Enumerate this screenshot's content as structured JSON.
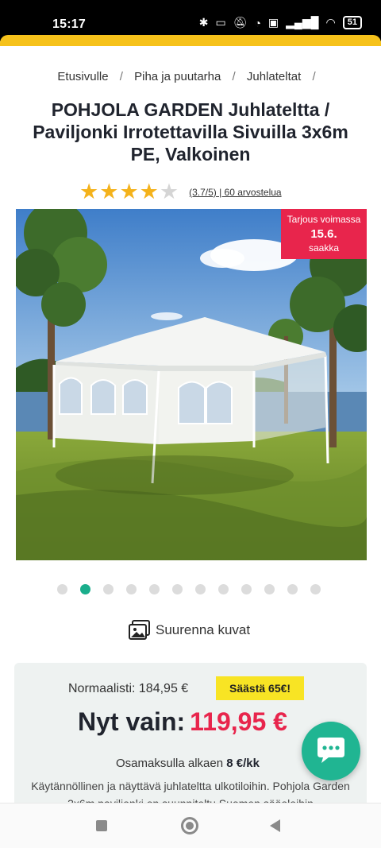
{
  "status_bar": {
    "time": "15:17",
    "battery": "51",
    "icons": [
      "bluetooth-icon",
      "nfc-icon",
      "mute-icon",
      "alarm-icon",
      "volte-icon",
      "signal-icon",
      "wifi-icon",
      "battery-icon"
    ]
  },
  "breadcrumb": [
    "Etusivulle",
    "Piha ja puutarha",
    "Juhlateltat"
  ],
  "product": {
    "title": "POHJOLA GARDEN Juhlateltta / Paviljonki Irrotettavilla Sivuilla 3x6m PE, Valkoinen",
    "rating_value": 3.7,
    "rating_max": 5,
    "rating_text": "(3.7/5) | 60 arvostelua",
    "offer_badge": {
      "line1": "Tarjous voimassa",
      "line2": "15.6.",
      "line3": "saakka"
    },
    "image_count": 12,
    "active_image": 2,
    "enlarge_label": "Suurenna kuvat"
  },
  "price": {
    "normal_label": "Normaalisti: 184,95 €",
    "save_label": "Säästä 65€!",
    "now_label": "Nyt vain:",
    "now_amount": "119,95 €",
    "installment_prefix": "Osamaksulla alkaen",
    "installment_amount": "8 €/kk",
    "description": "Käytännöllinen ja näyttävä juhlateltta ulkotiloihin. Pohjola Garden 3x6m paviljonki on suunniteltu Suomen sääoloihin"
  },
  "colors": {
    "accent_yellow": "#f6c21b",
    "price_red": "#e8254c",
    "chat_green": "#20b592",
    "dot_active": "#1aae8c"
  },
  "nav": [
    "recent-apps-button",
    "home-button",
    "back-button"
  ]
}
